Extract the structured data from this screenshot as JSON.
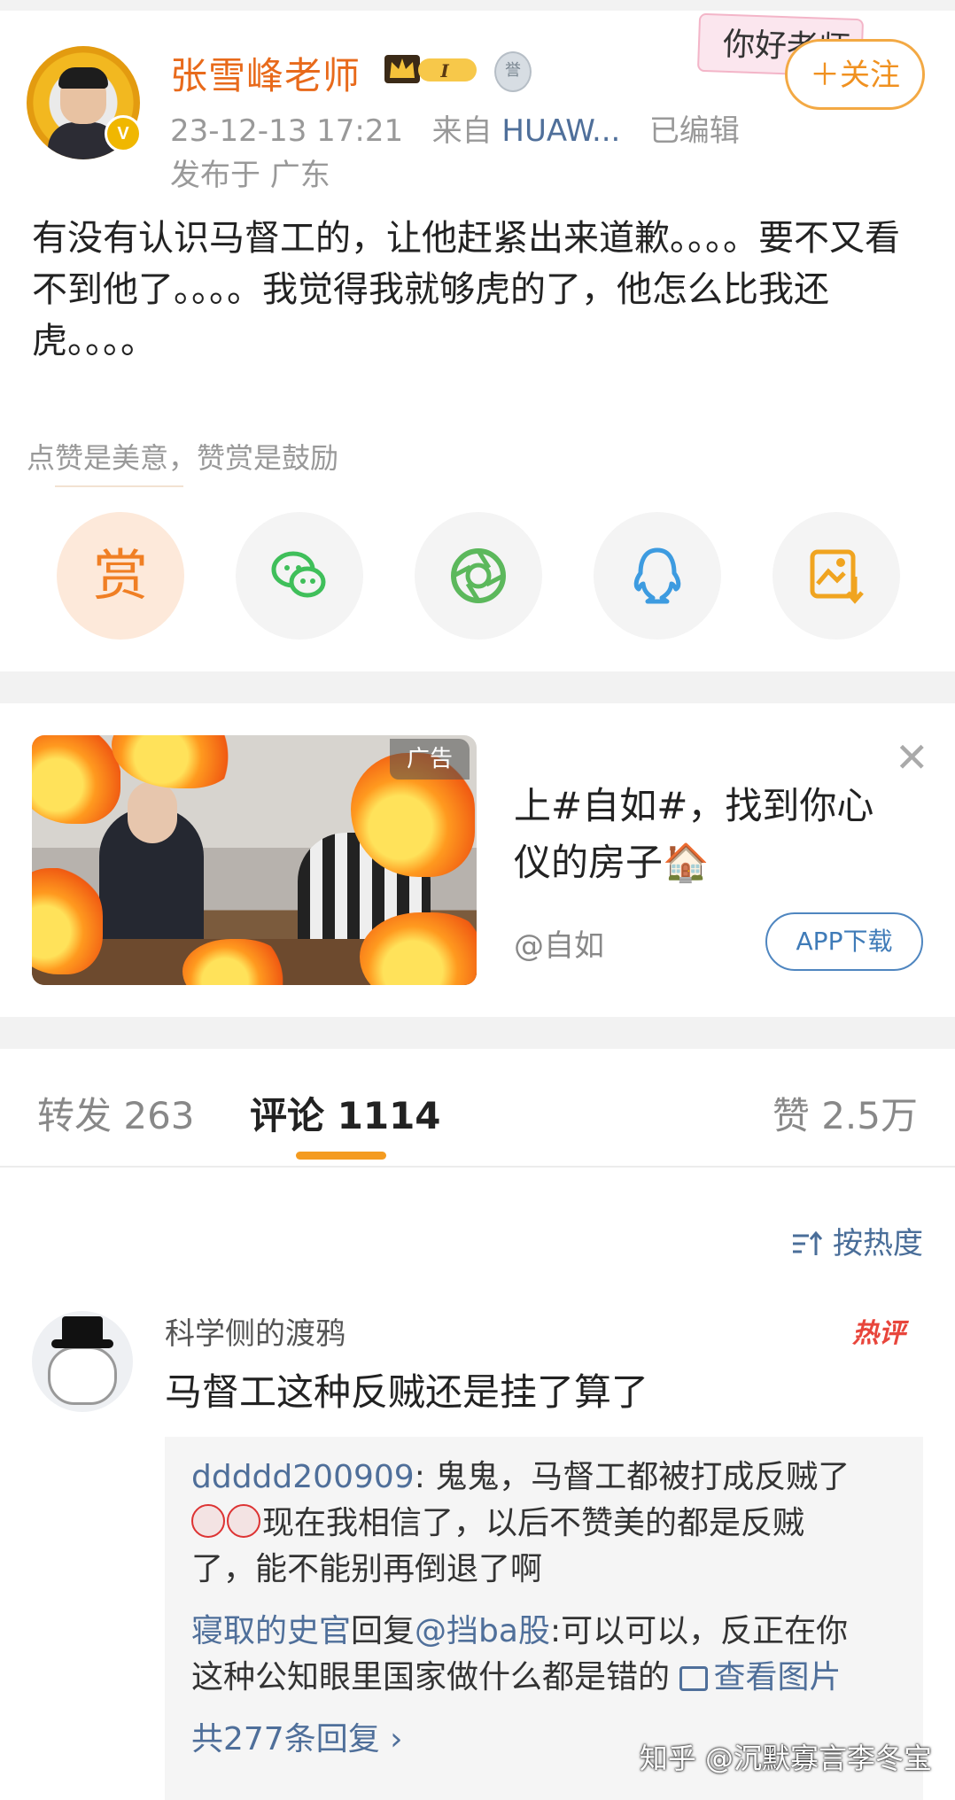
{
  "post": {
    "username": "张雪峰老师",
    "level": "I",
    "time": "23-12-13 17:21",
    "source_prefix": "来自",
    "source": "HUAW...",
    "edited": "已编辑",
    "location": "发布于 广东",
    "sticker": "你好老师",
    "follow": "＋关注",
    "text": "有没有认识马督工的，让他赶紧出来道歉。。。。要不又看不到他了。。。。我觉得我就够虎的了，他怎么比我还虎。。。。",
    "like_hint": "点赞是美意，赞赏是鼓励",
    "reward_label": "赏"
  },
  "share_icons": [
    "wechat-icon",
    "moments-icon",
    "qq-icon",
    "save-image-icon"
  ],
  "ad": {
    "tag": "广告",
    "title": "上#自如#，找到你心仪的房子🏠",
    "source": "@自如",
    "button": "APP下载"
  },
  "tabs": {
    "forward": "转发 263",
    "comments": "评论 1114",
    "likes": "赞 2.5万"
  },
  "sort_label": "按热度",
  "comment": {
    "name": "科学侧的渡鸦",
    "hot": "热评",
    "text": "马督工这种反贼还是挂了算了",
    "replies": [
      {
        "user": "ddddd200909",
        "line1": ": 鬼鬼，马督工都被打成反贼了",
        "line2": "现在我相信了，以后不赞美的都是反贼",
        "line3": "了，能不能别再倒退了啊"
      },
      {
        "user": "寝取的史官",
        "reply_word": "回复",
        "target": "@挡ba股",
        "line1": ":可以可以，反正在你",
        "line2": "这种公知眼里国家做什么都是错的",
        "image_link": "查看图片"
      }
    ],
    "more": "共277条回复 ›"
  },
  "watermark": "知乎 @沉默寡言李冬宝"
}
